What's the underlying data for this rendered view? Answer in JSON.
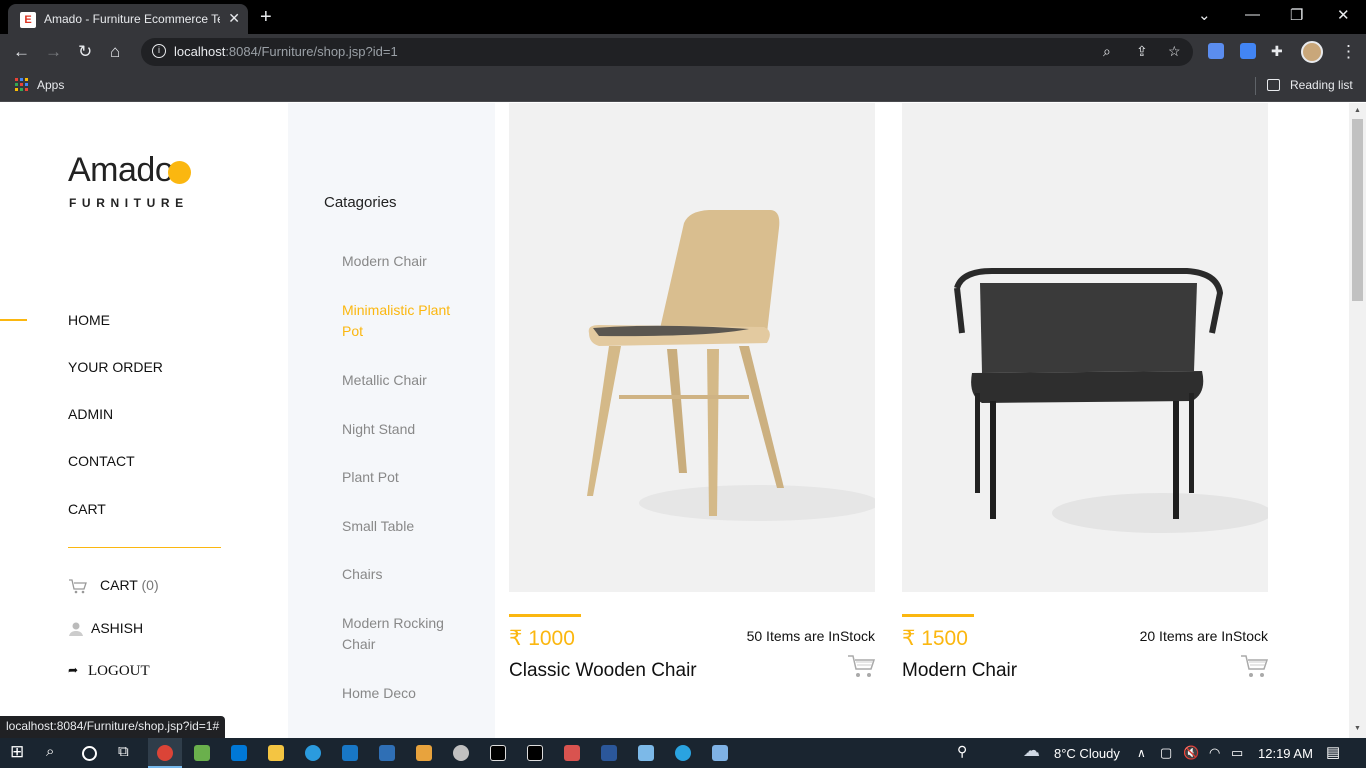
{
  "browser": {
    "tab_title": "Amado - Furniture Ecommerce Te",
    "favicon_letter": "E",
    "url_host": "localhost",
    "url_rest": ":8084/Furniture/shop.jsp?id=1",
    "bookmarks_apps": "Apps",
    "reading_list": "Reading list",
    "status_url": "localhost:8084/Furniture/shop.jsp?id=1#"
  },
  "logo": {
    "main": "Amado",
    "sub": "FURNITURE",
    "accent": "#fbb710"
  },
  "nav": {
    "items": [
      "HOME",
      "YOUR ORDER",
      "ADMIN",
      "CONTACT",
      "CART"
    ],
    "active": "HOME"
  },
  "side": {
    "cart_label": "CART",
    "cart_count": "(0)",
    "user": "ASHISH",
    "logout": "LOGOUT"
  },
  "categories": {
    "title": "Catagories",
    "items": [
      "Modern Chair",
      "Minimalistic Plant Pot",
      "Metallic Chair",
      "Night Stand",
      "Plant Pot",
      "Small Table",
      "Chairs",
      "Modern Rocking Chair",
      "Home Deco"
    ],
    "active": "Minimalistic Plant Pot"
  },
  "products": [
    {
      "price": "₹ 1000",
      "stock": "50 Items are InStock",
      "name": "Classic Wooden Chair"
    },
    {
      "price": "₹ 1500",
      "stock": "20 Items are InStock",
      "name": "Modern Chair"
    }
  ],
  "taskbar": {
    "weather": "8°C Cloudy",
    "time": "12:19 AM"
  }
}
